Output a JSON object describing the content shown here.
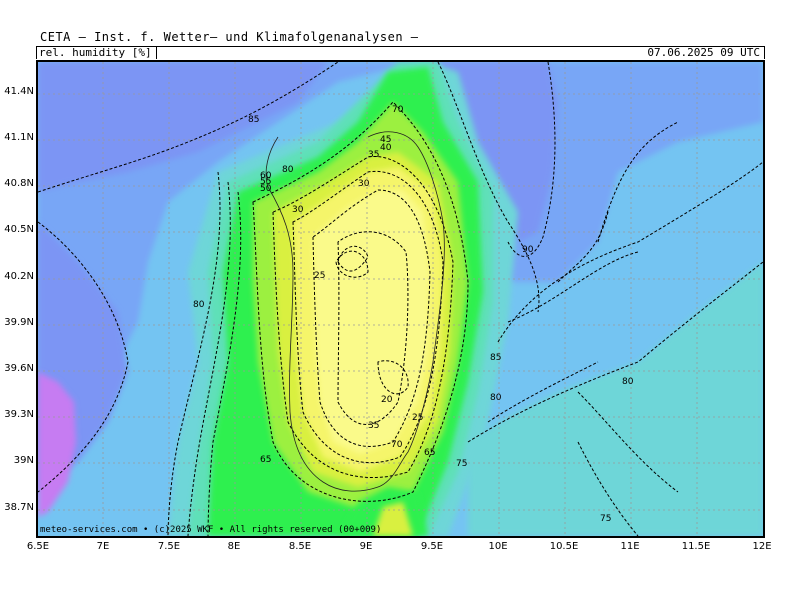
{
  "header": {
    "title": "CETA — Inst. f. Wetter— und Klimafolgenanalysen —",
    "variable": "rel. humidity [%]",
    "datetime": "07.06.2025 09 UTC"
  },
  "map": {
    "copyright": "meteo-services.com • (c)2025 WKF • All rights reserved (00+009)",
    "y_axis_labels": [
      "41.4N",
      "41.1N",
      "40.8N",
      "40.5N",
      "40.2N",
      "39.9N",
      "39.6N",
      "39.3N",
      "39N",
      "38.7N"
    ],
    "x_axis_labels": [
      "6.5E",
      "7E",
      "7.5E",
      "8E",
      "8.5E",
      "9E",
      "9.5E",
      "10E",
      "10.5E",
      "11E",
      "11.5E",
      "12E"
    ],
    "contour_labels": [
      "85",
      "70",
      "45",
      "40",
      "35",
      "80",
      "60",
      "55",
      "50",
      "30",
      "30",
      "25",
      "90",
      "80",
      "85",
      "80",
      "80",
      "20",
      "25",
      "35",
      "70",
      "65",
      "65",
      "75",
      "75"
    ],
    "colors": {
      "humid_90_plus": "#7b95f4",
      "humid_85_90": "#78a6f6",
      "humid_80_85": "#74c4f2",
      "humid_75_80": "#6ed6d8",
      "humid_70_75": "#5fe0b8",
      "humid_60_70": "#2ff050",
      "humid_50_60": "#9cf040",
      "humid_40_50": "#d9f040",
      "humid_30_40": "#f5f56a",
      "humid_below_30": "#fafa8a",
      "humid_extreme": "#c67cf2"
    }
  }
}
